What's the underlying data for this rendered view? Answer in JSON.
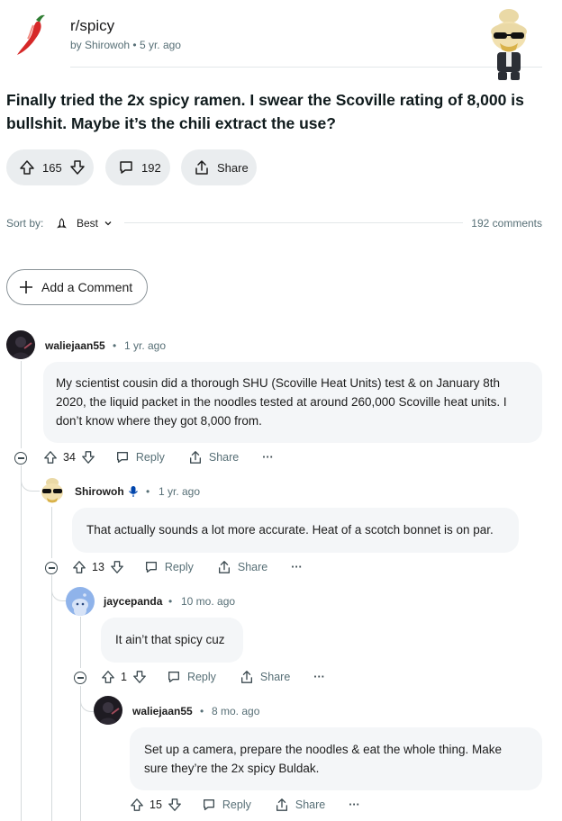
{
  "post": {
    "subreddit": "r/spicy",
    "byline_prefix": "by",
    "author": "Shirowoh",
    "separator": "•",
    "age": "5 yr. ago",
    "title": "Finally tried the 2x spicy ramen. I swear the Scoville rating of 8,000 is bullshit. Maybe it’s the chili extract the use?",
    "upvotes": "165",
    "comments_count": "192",
    "share_label": "Share"
  },
  "sort": {
    "label": "Sort by:",
    "value": "Best",
    "comments_total": "192 comments"
  },
  "add_comment_label": "Add a Comment",
  "comments": [
    {
      "user": "waliejaan55",
      "age": "1 yr. ago",
      "body": "My scientist cousin did a thorough SHU (Scoville Heat Units) test & on January 8th 2020, the liquid packet in the noodles tested at around 260,000 Scoville heat units. I don’t know where they got 8,000 from.",
      "votes": "34",
      "reply_label": "Reply",
      "share_label": "Share",
      "more_label": "···"
    },
    {
      "user": "Shirowoh",
      "age": "1 yr. ago",
      "body": "That actually sounds a lot more accurate. Heat of a scotch bonnet is on par.",
      "votes": "13",
      "reply_label": "Reply",
      "share_label": "Share",
      "more_label": "···"
    },
    {
      "user": "jaycepanda",
      "age": "10 mo. ago",
      "body": "It ain’t that spicy cuz",
      "votes": "1",
      "reply_label": "Reply",
      "share_label": "Share",
      "more_label": "···"
    },
    {
      "user": "waliejaan55",
      "age": "8 mo. ago",
      "body": "Set up a camera, prepare the noodles & eat the whole thing. Make sure they’re the 2x spicy Buldak.",
      "votes": "15",
      "reply_label": "Reply",
      "share_label": "Share",
      "more_label": "···"
    }
  ],
  "sep": "•",
  "colors": {
    "accent_blue": "#0045ac",
    "pill_bg": "#eaedef",
    "bubble_bg": "#f4f6f8"
  }
}
